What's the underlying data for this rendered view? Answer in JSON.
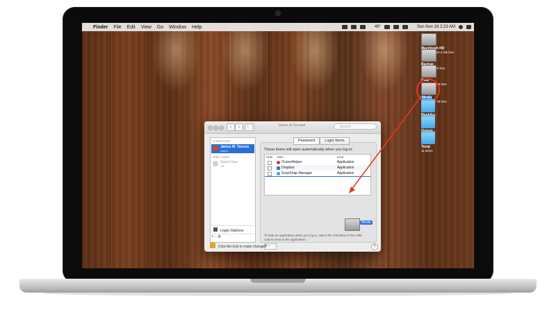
{
  "menubar": {
    "apple": "",
    "items": [
      "Finder",
      "File",
      "Edit",
      "View",
      "Go",
      "Window",
      "Help"
    ],
    "temperature": "49°",
    "clock": "Sun Nov 16  2:23 AM"
  },
  "desktop": {
    "icons": [
      {
        "name": "Macintosh HD",
        "sub": "256.4 GB, 10.4 GB free",
        "kind": "drive"
      },
      {
        "name": "Backup",
        "sub": "2 TB, 1.3 TB free",
        "kind": "drive"
      },
      {
        "name": "Data",
        "sub": "1 TB, 1.43 TB free",
        "kind": "drive"
      },
      {
        "name": "Media",
        "sub": "4 TB, 3.13 TB free",
        "kind": "drive"
      },
      {
        "name": "BookArc",
        "sub": "6 items",
        "kind": "folder"
      },
      {
        "name": "Output",
        "sub": "4 items",
        "kind": "folder"
      },
      {
        "name": "Temp",
        "sub": "11 items",
        "kind": "folder"
      }
    ]
  },
  "window": {
    "title": "Users & Groups",
    "search_placeholder": "Search",
    "sidebar": {
      "current_user_header": "Current User",
      "current_user_name": "James M. Tanous",
      "current_user_role": "Admin",
      "other_users_header": "Other Users",
      "guest_name": "Guest User",
      "guest_status": "Off",
      "login_options": "Login Options",
      "add_remove": "+  -   ⚙"
    },
    "tabs": [
      "Password",
      "Login Items"
    ],
    "heading": "These items will open automatically when you log in:",
    "table": {
      "headers": [
        "Hide",
        "Item",
        "Kind"
      ],
      "rows": [
        {
          "item": "iTunesHelper",
          "kind": "Application"
        },
        {
          "item": "Dropbox",
          "kind": "Application"
        },
        {
          "item": "ScanSnap Manager",
          "kind": "Application"
        }
      ]
    },
    "drag_label": "Media",
    "helper_text": "To hide an application when you log in, select the checkbox in the Hide column next to the application.",
    "add_remove": "+  -",
    "lock_text": "Click the lock to make changes.",
    "help": "?"
  },
  "colors": {
    "annotation": "#e53a1f",
    "selection": "#2a6fd6"
  }
}
